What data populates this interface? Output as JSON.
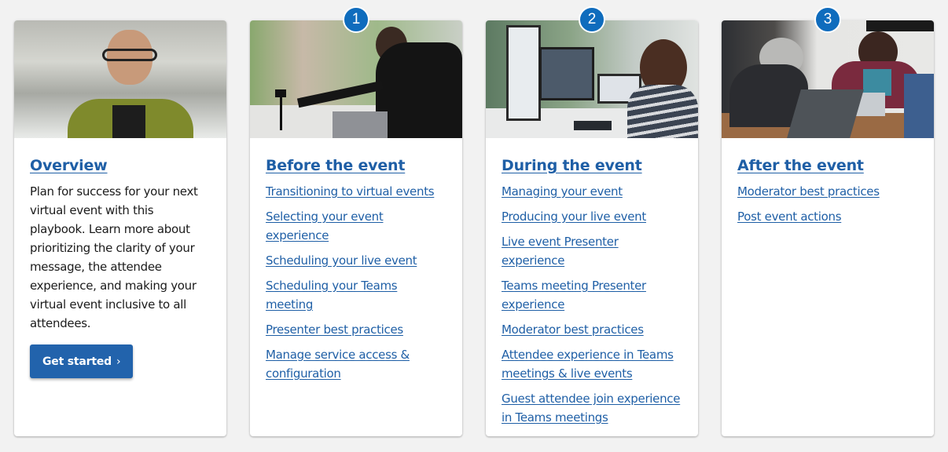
{
  "cards": [
    {
      "title": "Overview",
      "description": "Plan for success for your next virtual event with this playbook. Learn more about prioritizing the clarity of your message, the attendee experience, and making your virtual event inclusive to all attendees.",
      "button_label": "Get started",
      "button_icon": "chevron-right-icon",
      "image": "smiling man with glasses in green cardigan"
    },
    {
      "badge": "1",
      "title": "Before the event",
      "image": "woman with headset adjusting a camera on tripod",
      "links": [
        "Transitioning to virtual events",
        "Selecting your event experience",
        "Scheduling your live event",
        "Scheduling your Teams meeting",
        "Presenter best practices",
        "Manage service access & configuration"
      ]
    },
    {
      "badge": "2",
      "title": "During the event",
      "image": "woman at desk with monitors showing video call",
      "links": [
        "Managing your event",
        "Producing your live event",
        "Live event Presenter experience",
        "Teams meeting Presenter experience",
        "Moderator best practices",
        "Attendee experience in Teams meetings & live events",
        "Guest attendee join experience in Teams meetings"
      ]
    },
    {
      "badge": "3",
      "title": "After the event",
      "image": "two women talking at a table with laptops",
      "links": [
        "Moderator best practices",
        "Post event actions"
      ]
    }
  ],
  "colors": {
    "link": "#1f5fa6",
    "badge": "#0f6cbd",
    "button": "#2263ac",
    "background": "#f2f2f2"
  }
}
